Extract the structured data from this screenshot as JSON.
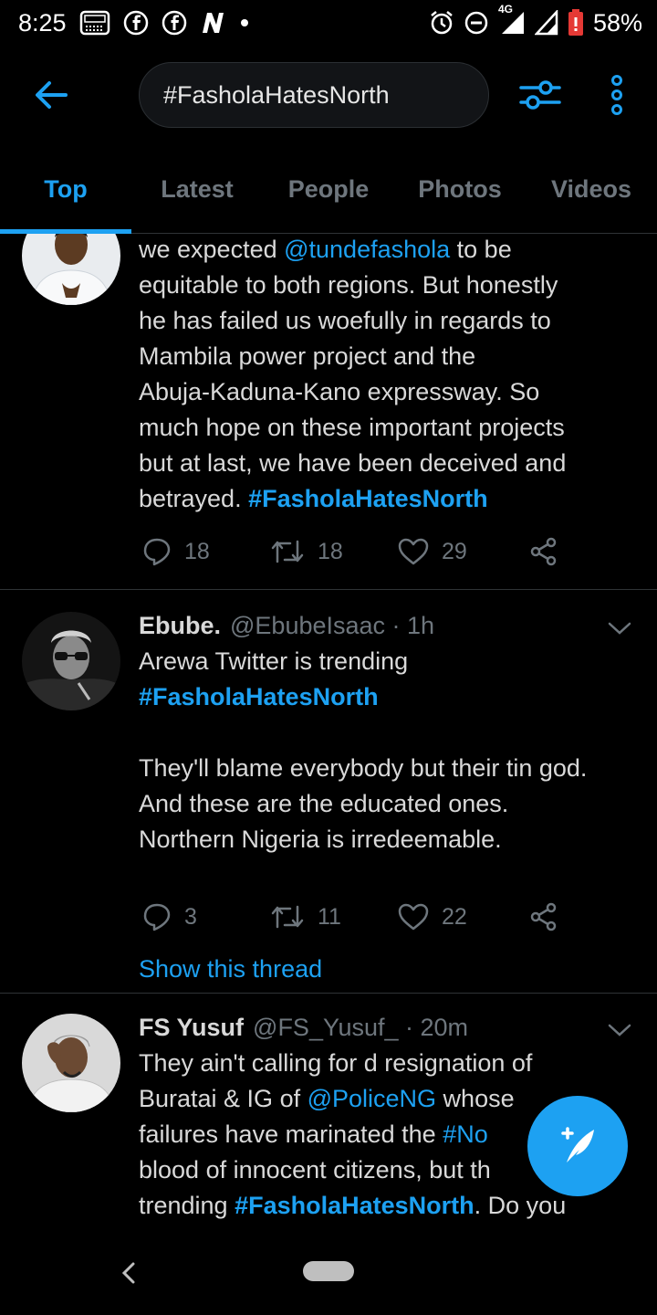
{
  "status_bar": {
    "time": "8:25",
    "network": "4G",
    "battery": "58%",
    "left_icons": [
      "radio-app-icon",
      "facebook-icon",
      "facebook-icon",
      "news-n-icon",
      "dot-icon"
    ],
    "right_icons": [
      "alarm-icon",
      "do-not-disturb-icon",
      "signal-icon",
      "signal-icon",
      "battery-icon"
    ]
  },
  "search": {
    "query": "#FasholaHatesNorth"
  },
  "tabs": [
    "Top",
    "Latest",
    "People",
    "Photos",
    "Videos"
  ],
  "active_tab": "Top",
  "tweets": [
    {
      "lines": [
        {
          "segments": [
            {
              "t": "we expected ",
              "s": "n"
            },
            {
              "t": "@tundefashola",
              "s": "link"
            },
            {
              "t": " to be",
              "s": "n"
            }
          ]
        },
        {
          "segments": [
            {
              "t": "equitable to both regions. But honestly",
              "s": "n"
            }
          ]
        },
        {
          "segments": [
            {
              "t": "he has failed us woefully in regards to",
              "s": "n"
            }
          ]
        },
        {
          "segments": [
            {
              "t": "Mambila power project and the",
              "s": "n"
            }
          ]
        },
        {
          "segments": [
            {
              "t": "Abuja-Kaduna-Kano expressway. So",
              "s": "n"
            }
          ]
        },
        {
          "segments": [
            {
              "t": "much hope on these important projects",
              "s": "n"
            }
          ]
        },
        {
          "segments": [
            {
              "t": "but at last, we have been deceived and",
              "s": "n"
            }
          ]
        },
        {
          "segments": [
            {
              "t": "betrayed. ",
              "s": "n"
            },
            {
              "t": "#FasholaHatesNorth",
              "s": "tag"
            }
          ]
        }
      ],
      "replies": "18",
      "retweets": "18",
      "likes": "29"
    },
    {
      "name": "Ebube.",
      "handle": "@EbubeIsaac · 1h",
      "para1": [
        {
          "segments": [
            {
              "t": "Arewa Twitter is trending",
              "s": "n"
            }
          ]
        },
        {
          "segments": [
            {
              "t": "#FasholaHatesNorth",
              "s": "tag"
            }
          ]
        }
      ],
      "para2": [
        {
          "segments": [
            {
              "t": "They'll blame everybody but their tin god.",
              "s": "n"
            }
          ]
        },
        {
          "segments": [
            {
              "t": "And these are the educated ones.",
              "s": "n"
            }
          ]
        },
        {
          "segments": [
            {
              "t": "Northern Nigeria is irredeemable.",
              "s": "n"
            }
          ]
        }
      ],
      "replies": "3",
      "retweets": "11",
      "likes": "22",
      "show_thread": "Show this thread"
    },
    {
      "name": "FS Yusuf",
      "handle": "@FS_Yusuf_ · 20m",
      "lines": [
        {
          "segments": [
            {
              "t": "They ain't calling for d resignation of",
              "s": "n"
            }
          ]
        },
        {
          "segments": [
            {
              "t": "Buratai & IG of ",
              "s": "n"
            },
            {
              "t": "@PoliceNG",
              "s": "link"
            },
            {
              "t": " whose",
              "s": "n"
            }
          ]
        },
        {
          "segments": [
            {
              "t": "failures have marinated the ",
              "s": "n"
            },
            {
              "t": "#No",
              "s": "link"
            }
          ]
        },
        {
          "segments": [
            {
              "t": "blood of innocent citizens, but th",
              "s": "n"
            }
          ]
        },
        {
          "segments": [
            {
              "t": "trending ",
              "s": "n"
            },
            {
              "t": "#FasholaHatesNorth",
              "s": "tag"
            },
            {
              "t": ". Do you",
              "s": "n"
            }
          ]
        }
      ]
    }
  ],
  "colors": {
    "accent": "#1da1f2",
    "background": "#000000",
    "text": "#d9d9d9",
    "muted": "#6e767d",
    "divider": "#2f3336"
  },
  "icons": {
    "back": "arrow-left-icon",
    "filter": "sliders-icon",
    "more": "vertical-ellipsis-icon",
    "compose": "compose-feather-icon",
    "reply": "reply-bubble-icon",
    "retweet": "retweet-icon",
    "like": "heart-icon",
    "share": "share-icon"
  }
}
